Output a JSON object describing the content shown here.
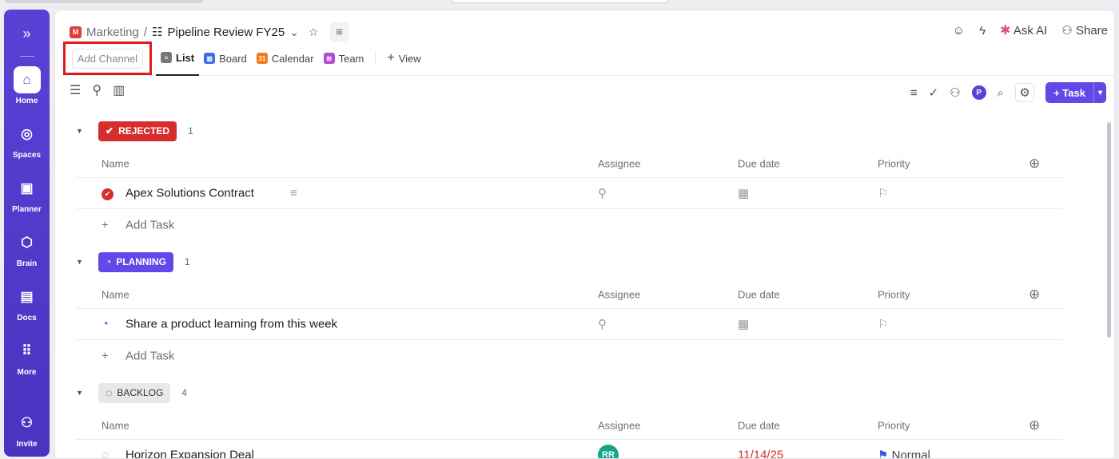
{
  "sidebar": {
    "items": [
      {
        "label": "Home"
      },
      {
        "label": "Spaces"
      },
      {
        "label": "Planner"
      },
      {
        "label": "Brain"
      },
      {
        "label": "Docs"
      },
      {
        "label": "More"
      }
    ],
    "invite": "Invite"
  },
  "breadcrumb": {
    "workspace_badge": "M",
    "workspace": "Marketing",
    "separator": "/",
    "list": "Pipeline Review FY25"
  },
  "header_actions": {
    "ask_ai": "Ask AI",
    "share": "Share"
  },
  "views": {
    "add_channel_placeholder": "Add Channel",
    "tabs": [
      {
        "label": "List"
      },
      {
        "label": "Board"
      },
      {
        "label": "Calendar",
        "icon_text": "31"
      },
      {
        "label": "Team"
      }
    ],
    "add_view": "View"
  },
  "toolbar": {
    "avatar": "P",
    "new_task": "Task"
  },
  "columns": {
    "name": "Name",
    "assignee": "Assignee",
    "due": "Due date",
    "priority": "Priority"
  },
  "add_task": "Add Task",
  "groups": [
    {
      "status": "REJECTED",
      "color": "#d62d2d",
      "count": "1",
      "tasks": [
        {
          "name": "Apex Solutions Contract"
        }
      ]
    },
    {
      "status": "PLANNING",
      "color": "#6347e8",
      "count": "1",
      "tasks": [
        {
          "name": "Share a product learning from this week"
        }
      ]
    },
    {
      "status": "BACKLOG",
      "color": "#e8e8ea",
      "count": "4",
      "tasks": [
        {
          "name": "Horizon Expansion Deal",
          "assignee": "RR",
          "due": "11/14/25",
          "priority": "Normal"
        }
      ]
    }
  ]
}
